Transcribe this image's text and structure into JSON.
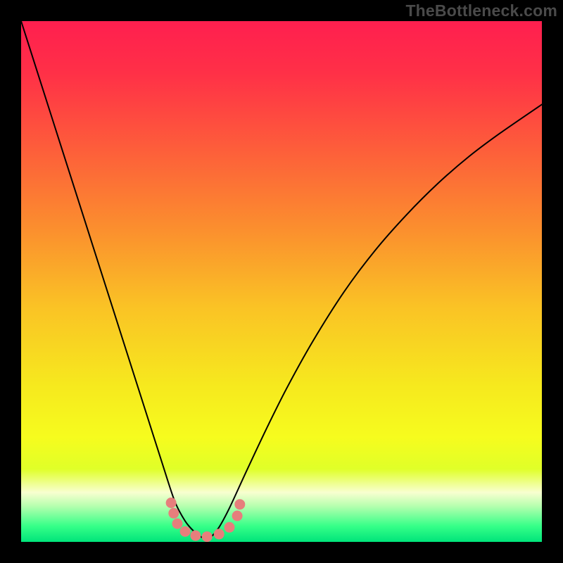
{
  "watermark": "TheBottleneck.com",
  "colors": {
    "frame": "#000000",
    "curve": "#000000",
    "marker_fill": "#e77e7c",
    "gradient_stops": [
      {
        "offset": 0.0,
        "color": "#ff1f4f"
      },
      {
        "offset": 0.1,
        "color": "#ff3047"
      },
      {
        "offset": 0.25,
        "color": "#fd5f3a"
      },
      {
        "offset": 0.4,
        "color": "#fb8f2e"
      },
      {
        "offset": 0.55,
        "color": "#fac325"
      },
      {
        "offset": 0.7,
        "color": "#f6e91e"
      },
      {
        "offset": 0.8,
        "color": "#f6fc1e"
      },
      {
        "offset": 0.86,
        "color": "#e0ff28"
      },
      {
        "offset": 0.905,
        "color": "#f8ffd0"
      },
      {
        "offset": 0.93,
        "color": "#baffb0"
      },
      {
        "offset": 0.97,
        "color": "#35ff88"
      },
      {
        "offset": 1.0,
        "color": "#00e47a"
      }
    ]
  },
  "chart_data": {
    "type": "line",
    "title": "",
    "xlabel": "",
    "ylabel": "",
    "xlim": [
      0,
      1
    ],
    "ylim": [
      0,
      1
    ],
    "series": [
      {
        "name": "bottleneck-curve",
        "x": [
          0.0,
          0.03,
          0.06,
          0.09,
          0.12,
          0.15,
          0.18,
          0.21,
          0.24,
          0.27,
          0.295,
          0.315,
          0.332,
          0.345,
          0.355,
          0.365,
          0.38,
          0.4,
          0.43,
          0.47,
          0.51,
          0.56,
          0.62,
          0.68,
          0.74,
          0.8,
          0.86,
          0.92,
          1.0
        ],
        "y": [
          1.0,
          0.906,
          0.812,
          0.718,
          0.624,
          0.53,
          0.436,
          0.342,
          0.248,
          0.154,
          0.078,
          0.04,
          0.02,
          0.01,
          0.006,
          0.01,
          0.028,
          0.065,
          0.13,
          0.215,
          0.295,
          0.385,
          0.48,
          0.56,
          0.628,
          0.688,
          0.74,
          0.785,
          0.84
        ]
      }
    ],
    "markers": {
      "name": "highlight-dots",
      "points": [
        {
          "x": 0.288,
          "y": 0.075
        },
        {
          "x": 0.293,
          "y": 0.055
        },
        {
          "x": 0.3,
          "y": 0.035
        },
        {
          "x": 0.315,
          "y": 0.02
        },
        {
          "x": 0.335,
          "y": 0.012
        },
        {
          "x": 0.357,
          "y": 0.01
        },
        {
          "x": 0.38,
          "y": 0.015
        },
        {
          "x": 0.4,
          "y": 0.028
        },
        {
          "x": 0.415,
          "y": 0.05
        },
        {
          "x": 0.42,
          "y": 0.072
        }
      ]
    }
  }
}
